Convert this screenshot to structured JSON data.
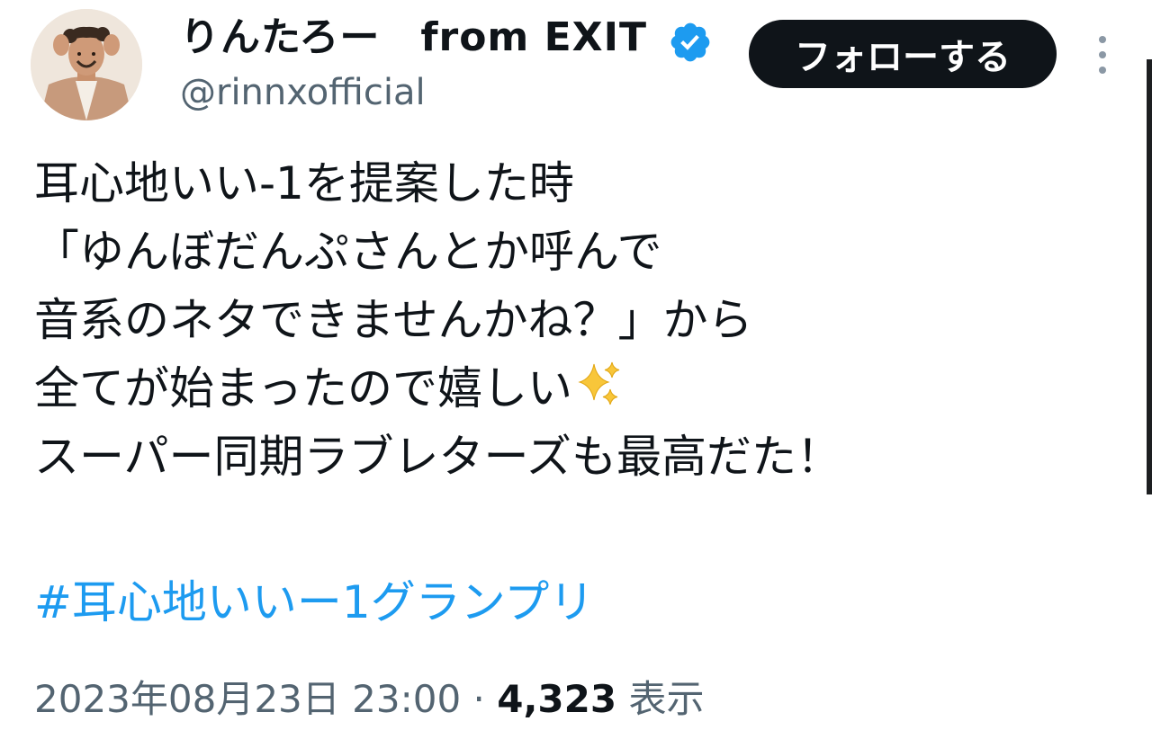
{
  "author": {
    "display_name": "りんたろー　from EXIT",
    "handle": "@rinnxofficial",
    "verified": true,
    "avatar_icon": "profile-photo",
    "verified_icon": "verified-badge-icon"
  },
  "actions": {
    "follow_label": "フォローする",
    "more_icon": "more-vertical-icon"
  },
  "tweet": {
    "lines": [
      "耳心地いい-1を提案した時",
      "「ゆんぼだんぷさんとか呼んで",
      "音系のネタできませんかね？」から",
      "全てが始まったので嬉しい",
      "スーパー同期ラブレターズも最高だた！"
    ],
    "emoji": "✨",
    "hashtag": "#耳心地いいー1グランプリ"
  },
  "meta": {
    "timestamp": "2023年08月23日 23:00",
    "separator": "·",
    "views_count": "4,323",
    "views_label": "表示"
  },
  "colors": {
    "text": "#0f1419",
    "secondary": "#536471",
    "link": "#1d9bf0",
    "verified": "#1d9bf0",
    "follow_bg": "#0f1419",
    "follow_text": "#ffffff"
  }
}
